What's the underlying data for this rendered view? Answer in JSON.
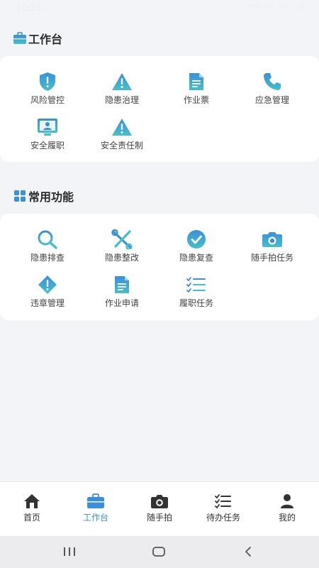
{
  "status_bar": {
    "time": "16:16",
    "indicators": "HD 4G 5G all"
  },
  "workbench": {
    "title": "工作台",
    "items": [
      {
        "label": "风险管控",
        "icon": "shield-alert-icon"
      },
      {
        "label": "隐患治理",
        "icon": "warning-triangle-icon"
      },
      {
        "label": "作业票",
        "icon": "document-icon"
      },
      {
        "label": "应急管理",
        "icon": "phone-icon"
      },
      {
        "label": "安全履职",
        "icon": "monitor-user-icon"
      },
      {
        "label": "安全责任制",
        "icon": "warning-triangle-icon"
      }
    ]
  },
  "common": {
    "title": "常用功能",
    "items": [
      {
        "label": "隐患排查",
        "icon": "search-icon"
      },
      {
        "label": "隐患整改",
        "icon": "tools-icon"
      },
      {
        "label": "隐患复查",
        "icon": "check-circle-icon"
      },
      {
        "label": "随手拍任务",
        "icon": "camera-icon"
      },
      {
        "label": "违章管理",
        "icon": "diamond-alert-icon"
      },
      {
        "label": "作业申请",
        "icon": "document-icon"
      },
      {
        "label": "履职任务",
        "icon": "checklist-icon"
      }
    ]
  },
  "tab_bar": {
    "active": "工作台",
    "tabs": [
      {
        "label": "首页",
        "icon": "home-icon"
      },
      {
        "label": "工作台",
        "icon": "briefcase-icon"
      },
      {
        "label": "随手拍",
        "icon": "camera-icon"
      },
      {
        "label": "待办任务",
        "icon": "checklist-icon"
      },
      {
        "label": "我的",
        "icon": "user-icon"
      }
    ]
  },
  "colors": {
    "accent": "#3a8fd8",
    "teal": "#3fb6c6",
    "background": "#f2f4f8"
  }
}
